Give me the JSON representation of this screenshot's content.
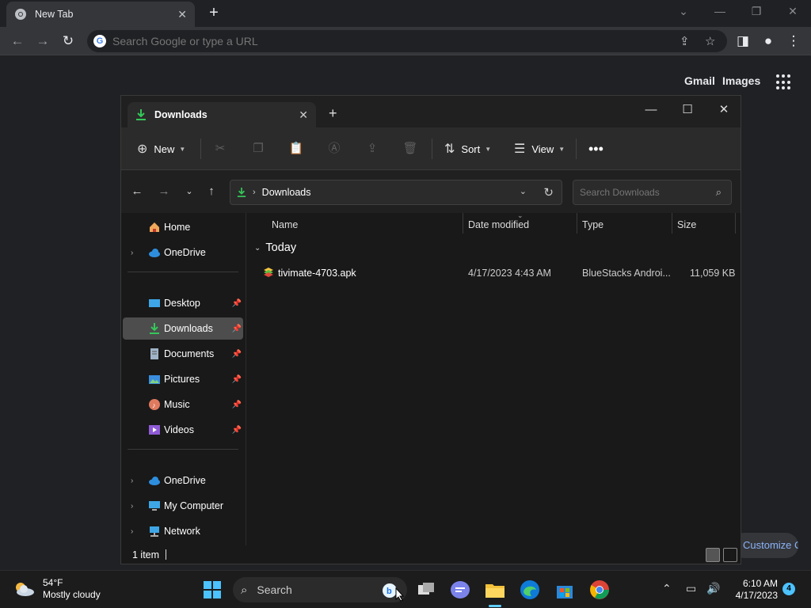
{
  "browser": {
    "tab_title": "New Tab",
    "omnibox_placeholder": "Search Google or type a URL",
    "links": {
      "gmail": "Gmail",
      "images": "Images"
    },
    "customize_label": "Customize Chrome"
  },
  "explorer": {
    "tab_title": "Downloads",
    "commands": {
      "new": "New",
      "sort": "Sort",
      "view": "View"
    },
    "address": "Downloads",
    "search_placeholder": "Search Downloads",
    "nav": {
      "home": "Home",
      "onedrive_top": "OneDrive",
      "desktop": "Desktop",
      "downloads": "Downloads",
      "documents": "Documents",
      "pictures": "Pictures",
      "music": "Music",
      "videos": "Videos",
      "onedrive": "OneDrive",
      "my_computer": "My Computer",
      "network": "Network"
    },
    "columns": {
      "name": "Name",
      "date": "Date modified",
      "type": "Type",
      "size": "Size"
    },
    "group": "Today",
    "files": [
      {
        "name": "tivimate-4703.apk",
        "date": "4/17/2023 4:43 AM",
        "type": "BlueStacks Androi...",
        "size": "11,059 KB"
      }
    ],
    "status_count": "1 item"
  },
  "taskbar": {
    "weather_temp": "54°F",
    "weather_desc": "Mostly cloudy",
    "search_label": "Search",
    "time": "6:10 AM",
    "date": "4/17/2023",
    "notification_count": "4"
  },
  "colors": {
    "accent": "#60cdff",
    "downloads_green": "#34c759",
    "chrome_bg": "#202124"
  }
}
